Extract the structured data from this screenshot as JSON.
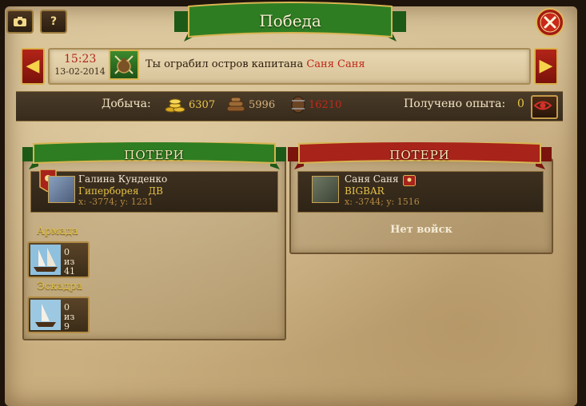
{
  "window": {
    "title": "Победа",
    "top_buttons": [
      "camera-icon",
      "help-icon"
    ],
    "help_glyph": "?",
    "close_icon": "close-icon"
  },
  "event": {
    "time": "15:23",
    "date": "13-02-2014",
    "text": "Ты ограбил остров капитана",
    "name": "Саня Саня",
    "prev_arrow": "◀",
    "next_arrow": "▶"
  },
  "loot": {
    "label": "Добыча:",
    "gold": "6307",
    "wood": "5996",
    "rum": "16210",
    "exp_label": "Получено опыта:",
    "exp_value": "0"
  },
  "left_panel": {
    "ribbon": "ПОТЕРИ",
    "player": {
      "name": "Галина Кунденко",
      "alliance": "Гиперборея",
      "tag": "ДВ",
      "coords": "x: -3774; y: 1231"
    },
    "units": [
      {
        "category": "Армада",
        "count": "0",
        "of": "из",
        "total": "41"
      },
      {
        "category": "Эскадра",
        "count": "0",
        "of": "из",
        "total": "9"
      }
    ]
  },
  "right_panel": {
    "ribbon": "ПОТЕРИ",
    "player": {
      "name": "Саня Саня",
      "alliance": "BIGBAR",
      "coords": "x: -3744; y: 1516"
    },
    "no_troops": "Нет войск"
  },
  "colors": {
    "green_ribbon": "#2f7d22",
    "red_ribbon": "#a8231a",
    "gold": "#e8c64a"
  }
}
